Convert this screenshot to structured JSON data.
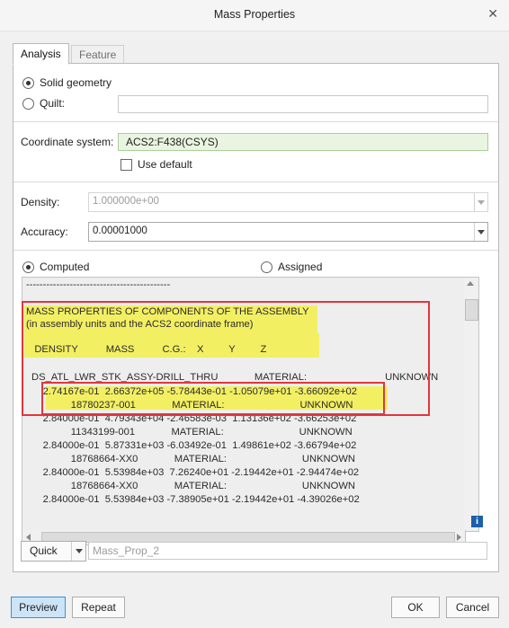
{
  "window": {
    "title": "Mass Properties",
    "close_glyph": "✕"
  },
  "tabs": [
    {
      "label": "Analysis",
      "active": true
    },
    {
      "label": "Feature",
      "active": false
    }
  ],
  "geometry": {
    "solid_label": "Solid geometry",
    "solid_selected": true,
    "quilt_label": "Quilt:",
    "quilt_value": ""
  },
  "coordinate": {
    "label": "Coordinate system:",
    "value": "ACS2:F438(CSYS)",
    "use_default_label": "Use default",
    "use_default_checked": false
  },
  "density": {
    "label": "Density:",
    "value": "1.000000e+00"
  },
  "accuracy": {
    "label": "Accuracy:",
    "value": "0.00001000"
  },
  "mode": {
    "computed_label": "Computed",
    "assigned_label": "Assigned",
    "selected": "Computed"
  },
  "results": {
    "lines": [
      "-------------------------------------------",
      "",
      "MASS PROPERTIES OF COMPONENTS OF THE ASSEMBLY",
      "(in assembly units and the ACS2 coordinate frame)",
      "",
      "   DENSITY          MASS          C.G.:    X         Y         Z",
      "",
      "DS_ATL_LWR_STK_ASSY-DRILL_THRU             MATERIAL:                            UNKNOWN",
      "      2.74167e-01  2.66372e+05 -5.78443e-01 -1.05079e+01 -3.66092e+02",
      "                18780237-001             MATERIAL:                           UNKNOWN",
      "      2.84000e-01  4.79343e+04 -2.46583e-03  1.13136e+02 -3.66253e+02",
      "                11343199-001             MATERIAL:                           UNKNOWN",
      "      2.84000e-01  5.87331e+03 -6.03492e-01  1.49861e+02 -3.66794e+02",
      "                18768664-XX0             MATERIAL:                           UNKNOWN",
      "      2.84000e-01  5.53984e+03  7.26240e+01 -2.19442e+01 -2.94474e+02",
      "                18768664-XX0             MATERIAL:                           UNKNOWN",
      "      2.84000e-01  5.53984e+03 -7.38905e+01 -2.19442e+01 -4.39026e+02"
    ]
  },
  "info_glyph": "i",
  "quick": {
    "label": "Quick",
    "name_placeholder": "Mass_Prop_2"
  },
  "buttons": {
    "preview": "Preview",
    "repeat": "Repeat",
    "ok": "OK",
    "cancel": "Cancel"
  },
  "colors": {
    "highlight": "#f3ef63",
    "annotation_red": "#e0363d",
    "cs_field_bg": "#eaf5e1",
    "preview_bg": "#cce4f7"
  }
}
